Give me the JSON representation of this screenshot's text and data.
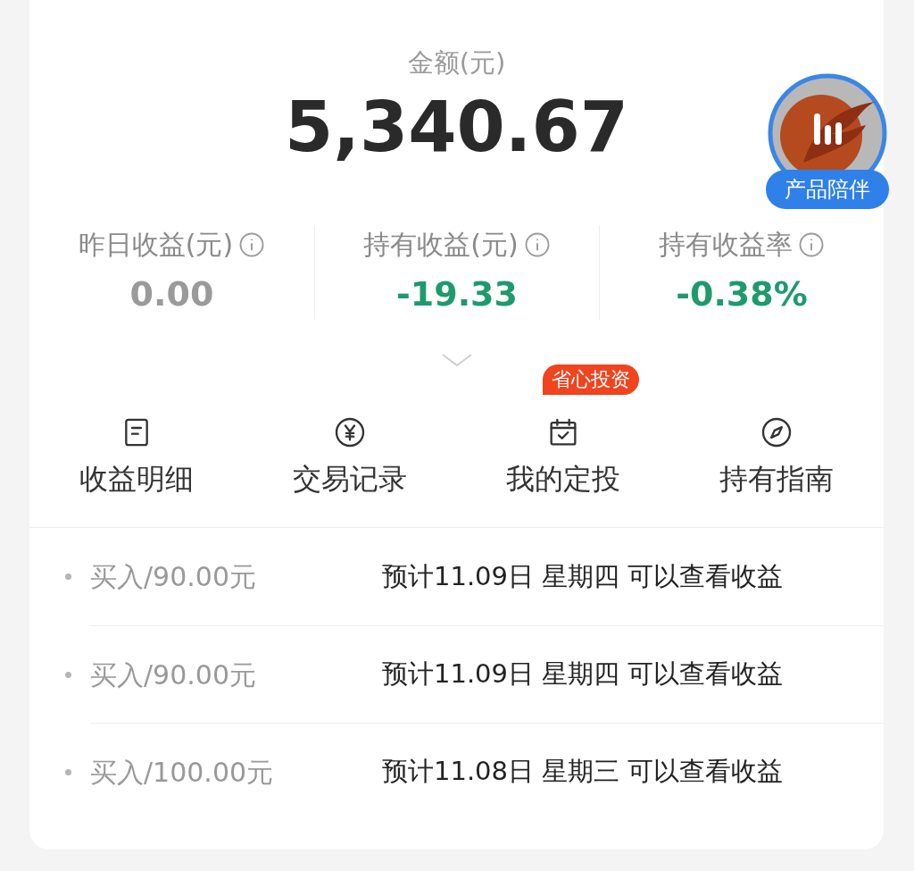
{
  "amount": {
    "label": "金额(元)",
    "value": "5,340.67"
  },
  "companion_badge": {
    "label": "产品陪伴"
  },
  "stats": [
    {
      "label": "昨日收益(元)",
      "value": "0.00",
      "color": "#9a9a9a"
    },
    {
      "label": "持有收益(元)",
      "value": "-19.33",
      "color": "#1e9a6e"
    },
    {
      "label": "持有收益率",
      "value": "-0.38%",
      "color": "#1e9a6e"
    }
  ],
  "actions": [
    {
      "label": "收益明细",
      "kind": "document"
    },
    {
      "label": "交易记录",
      "kind": "yen"
    },
    {
      "label": "我的定投",
      "kind": "calendar",
      "tag": "省心投资"
    },
    {
      "label": "持有指南",
      "kind": "compass"
    }
  ],
  "records": [
    {
      "trade": "买入/90.00元",
      "note": "预计11.09日 星期四 可以查看收益"
    },
    {
      "trade": "买入/90.00元",
      "note": "预计11.09日 星期四 可以查看收益"
    },
    {
      "trade": "买入/100.00元",
      "note": "预计11.08日 星期三 可以查看收益"
    }
  ]
}
